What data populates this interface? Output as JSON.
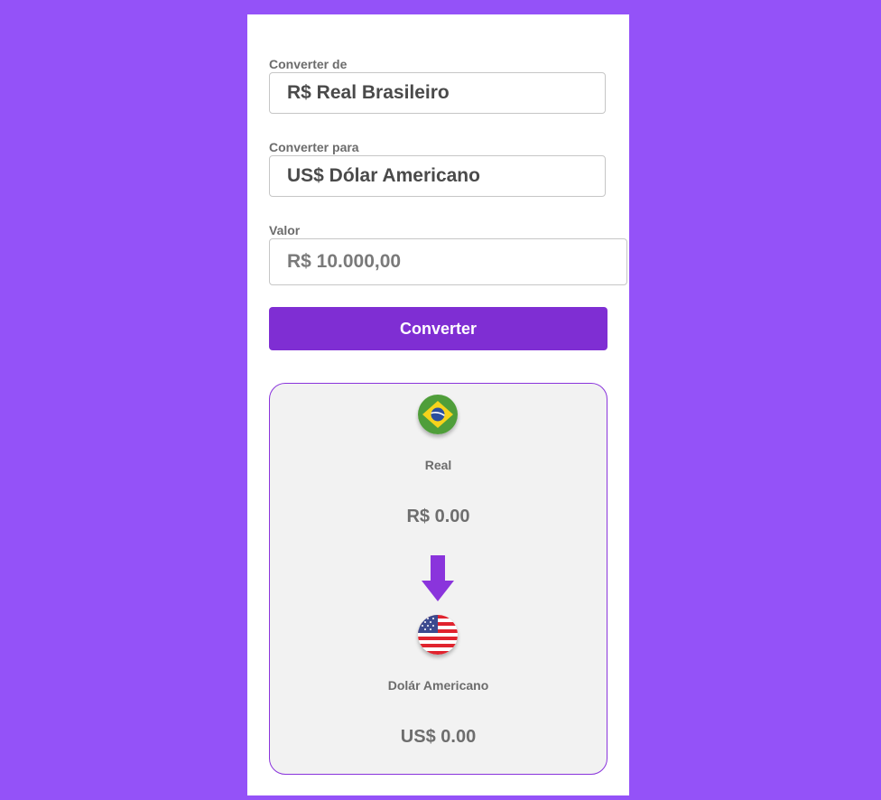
{
  "form": {
    "from_label": "Converter de",
    "from_value": "R$ Real Brasileiro",
    "to_label": "Converter para",
    "to_value": "US$ Dólar Americano",
    "amount_label": "Valor",
    "amount_value": "R$ 10.000,00",
    "convert_button": "Converter"
  },
  "result": {
    "from": {
      "icon": "brazil-flag-icon",
      "name": "Real",
      "amount": "R$ 0.00"
    },
    "to": {
      "icon": "usa-flag-icon",
      "name": "Dolár Americano",
      "amount": "US$ 0.00"
    },
    "arrow_icon": "arrow-down-icon"
  },
  "colors": {
    "background": "#9452f8",
    "accent": "#7f2ed3",
    "card": "#ffffff",
    "result_bg": "#f2f2f2"
  }
}
